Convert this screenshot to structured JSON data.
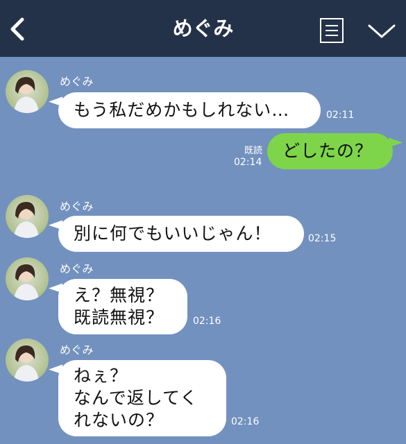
{
  "header": {
    "title": "めぐみ",
    "back_icon": "chevron-left-icon",
    "menu_icon": "list-icon",
    "expand_icon": "chevron-down-icon",
    "background": "#243249"
  },
  "chat": {
    "background": "#7291be",
    "incoming_bubble_color": "#ffffff",
    "outgoing_bubble_color": "#7ed54a"
  },
  "messages": [
    {
      "sender": "めぐみ",
      "lines": [
        "もう私だめかもしれない…"
      ],
      "time": "02:11"
    },
    {
      "read_label": "既読",
      "lines": [
        "どしたの？"
      ],
      "time": "02:14"
    },
    {
      "sender": "めぐみ",
      "lines": [
        "別に何でもいいじゃん！"
      ],
      "time": "02:15"
    },
    {
      "sender": "めぐみ",
      "lines": [
        "え？無視？",
        "既読無視？"
      ],
      "time": "02:16"
    },
    {
      "sender": "めぐみ",
      "lines": [
        "ねぇ？",
        "なんで返してく",
        "れないの？"
      ],
      "time": "02:16"
    }
  ]
}
